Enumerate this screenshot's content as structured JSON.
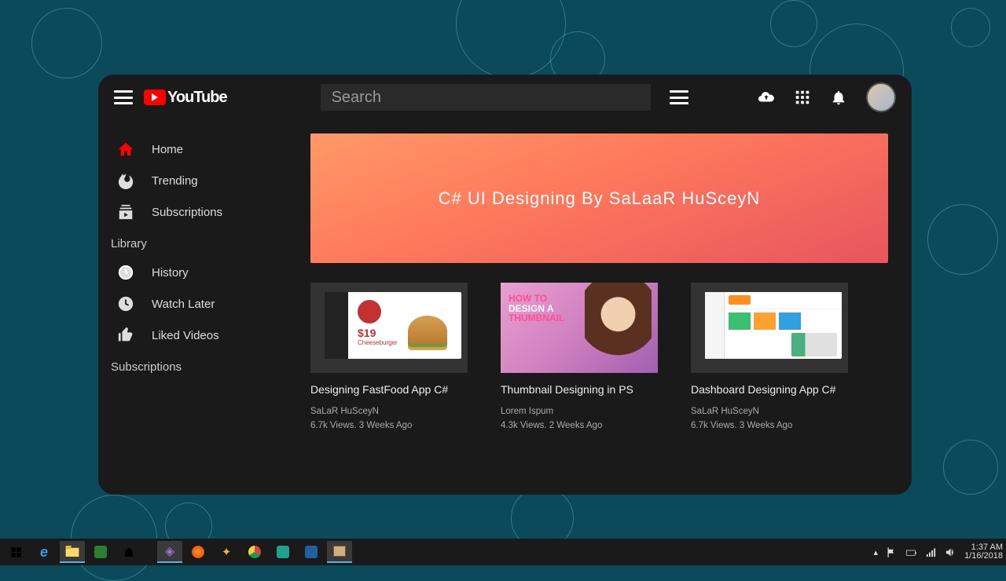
{
  "brand": "YouTube",
  "search": {
    "placeholder": "Search",
    "value": ""
  },
  "sidebar": {
    "items": [
      {
        "label": "Home",
        "icon": "home",
        "active": true
      },
      {
        "label": "Trending",
        "icon": "flame"
      },
      {
        "label": "Subscriptions",
        "icon": "subscriptions"
      }
    ],
    "library_title": "Library",
    "library_items": [
      {
        "label": "History",
        "icon": "history"
      },
      {
        "label": "Watch Later",
        "icon": "clock"
      },
      {
        "label": "Liked Videos",
        "icon": "thumb-up"
      }
    ],
    "subs_title": "Subscriptions"
  },
  "banner": {
    "text": "C# UI Designing By SaLaaR HuSceyN"
  },
  "videos": [
    {
      "title": "Designing FastFood App C#",
      "author": "SaLaR HuSceyN",
      "meta": "6.7k Views. 3 Weeks Ago",
      "thumb": {
        "price": "$19",
        "plabel": "Cheeseburger"
      }
    },
    {
      "title": "Thumbnail Designing in PS",
      "author": "Lorem Ispum",
      "meta": "4.3k Views. 2 Weeks Ago",
      "thumb": {
        "overlay": "HOW TO DESIGN A THUMBNAIL"
      }
    },
    {
      "title": "Dashboard Designing App C#",
      "author": "SaLaR HuSceyN",
      "meta": "6.7k Views. 3 Weeks Ago"
    }
  ],
  "taskbar": {
    "time": "1:37 AM",
    "date": "1/16/2018"
  }
}
